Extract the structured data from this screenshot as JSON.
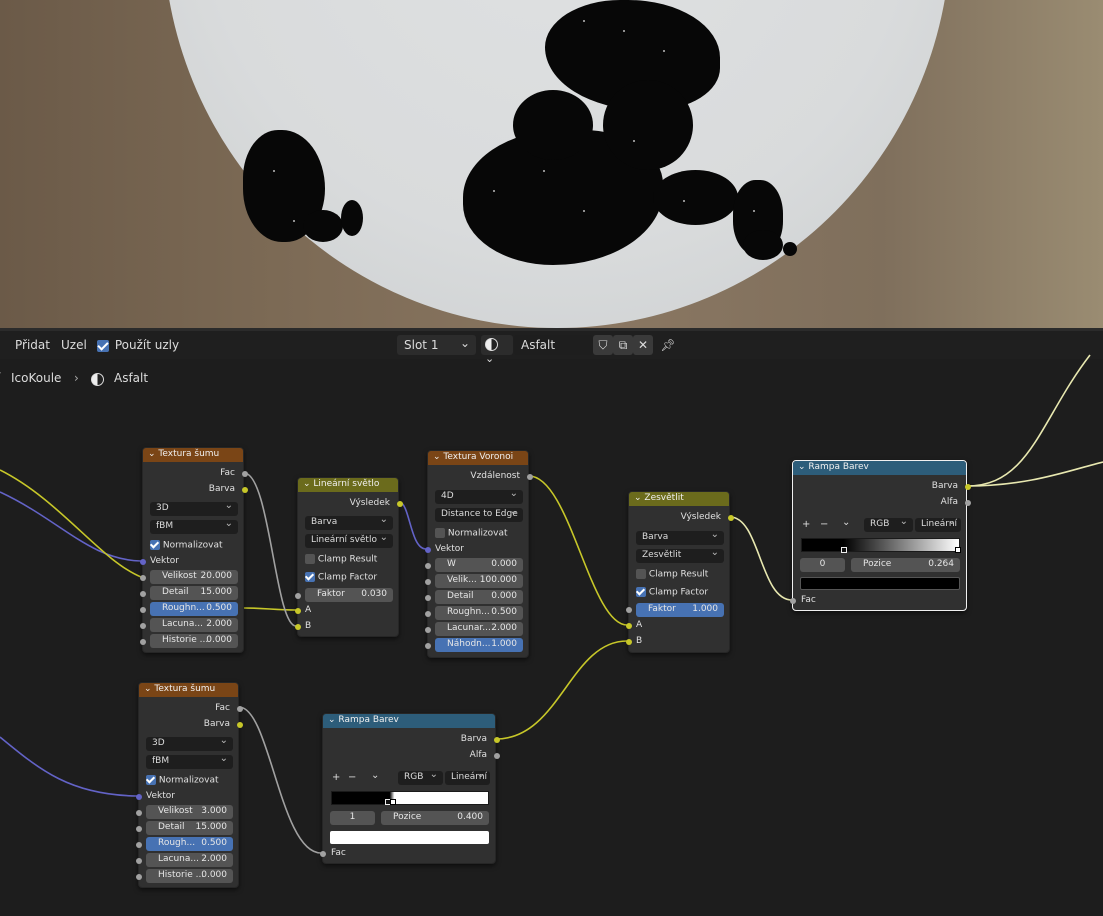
{
  "header": {
    "menu_add": "Přidat",
    "menu_node": "Uzel",
    "use_nodes_label": "Použít uzly",
    "use_nodes_checked": true,
    "slot": "Slot 1",
    "material_name": "Asfalt"
  },
  "breadcrumb": {
    "object": "IcoKoule",
    "material": "Asfalt"
  },
  "nodes": {
    "noise1": {
      "title": "Textura šumu",
      "out_fac": "Fac",
      "out_color": "Barva",
      "dim": "3D",
      "type": "fBM",
      "normalize": "Normalizovat",
      "vector": "Vektor",
      "size_label": "Velikost",
      "size": "20.000",
      "detail_label": "Detail",
      "detail": "15.000",
      "rough_label": "Roughn...",
      "rough": "0.500",
      "lac_label": "Lacuna...",
      "lac": "2.000",
      "hist_label": "Historie ...",
      "hist": "0.000"
    },
    "linear": {
      "title": "Lineární světlo",
      "out": "Výsledek",
      "type": "Barva",
      "mode": "Lineární světlo",
      "clamp_result": "Clamp Result",
      "clamp_factor": "Clamp Factor",
      "factor_label": "Faktor",
      "factor": "0.030",
      "a": "A",
      "b": "B"
    },
    "voronoi": {
      "title": "Textura Voronoi",
      "out": "Vzdálenost",
      "dim": "4D",
      "feature": "Distance to Edge",
      "normalize": "Normalizovat",
      "vector": "Vektor",
      "w_label": "W",
      "w": "0.000",
      "size_label": "Velik...",
      "size": "100.000",
      "detail_label": "Detail",
      "detail": "0.000",
      "rough_label": "Roughn...",
      "rough": "0.500",
      "lac_label": "Lacunar...",
      "lac": "2.000",
      "rand_label": "Náhodn...",
      "rand": "1.000"
    },
    "lighten": {
      "title": "Zesvětlit",
      "out": "Výsledek",
      "type": "Barva",
      "mode": "Zesvětlit",
      "clamp_result": "Clamp Result",
      "clamp_factor": "Clamp Factor",
      "factor_label": "Faktor",
      "factor": "1.000",
      "a": "A",
      "b": "B"
    },
    "ramp1": {
      "title": "Rampa Barev",
      "out_color": "Barva",
      "out_alpha": "Alfa",
      "mode": "RGB",
      "interp": "Lineární",
      "index": "0",
      "pos_label": "Pozice",
      "pos": "0.264",
      "in_fac": "Fac"
    },
    "noise2": {
      "title": "Textura šumu",
      "out_fac": "Fac",
      "out_color": "Barva",
      "dim": "3D",
      "type": "fBM",
      "normalize": "Normalizovat",
      "vector": "Vektor",
      "size_label": "Velikost",
      "size": "3.000",
      "detail_label": "Detail",
      "detail": "15.000",
      "rough_label": "Rough...",
      "rough": "0.500",
      "lac_label": "Lacuna...",
      "lac": "2.000",
      "hist_label": "Historie ...",
      "hist": "0.000"
    },
    "ramp2": {
      "title": "Rampa Barev",
      "out_color": "Barva",
      "out_alpha": "Alfa",
      "mode": "RGB",
      "interp": "Lineární",
      "index": "1",
      "pos_label": "Pozice",
      "pos": "0.400",
      "in_fac": "Fac"
    }
  },
  "colors": {
    "texture_header": "#7a4516",
    "converter_header": "#2d5d7a",
    "color_header": "#6b6b1c",
    "selected_value": "#4772b3",
    "socket_float": "#a1a1a1",
    "socket_color": "#c7c729",
    "socket_vector": "#6363c7"
  }
}
